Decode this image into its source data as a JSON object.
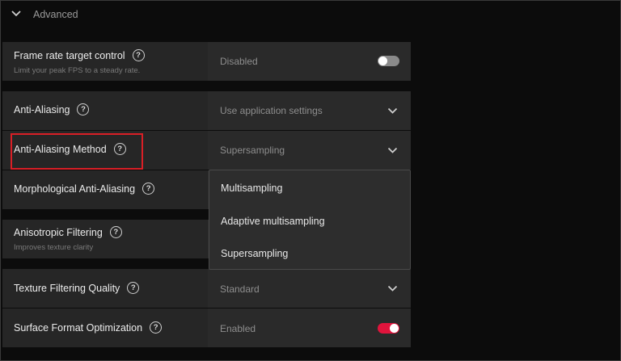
{
  "section": {
    "title": "Advanced"
  },
  "rows": {
    "frame_rate": {
      "label": "Frame rate target control",
      "sublabel": "Limit your peak FPS to a steady rate.",
      "value": "Disabled",
      "toggle_on": false
    },
    "anti_aliasing": {
      "label": "Anti-Aliasing",
      "value": "Use application settings"
    },
    "aa_method": {
      "label": "Anti-Aliasing Method",
      "value": "Supersampling"
    },
    "morphological": {
      "label": "Morphological Anti-Aliasing"
    },
    "anisotropic": {
      "label": "Anisotropic Filtering",
      "sublabel": "Improves texture clarity"
    },
    "texture_quality": {
      "label": "Texture Filtering Quality",
      "value": "Standard"
    },
    "surface_format": {
      "label": "Surface Format Optimization",
      "value": "Enabled",
      "toggle_on": true
    }
  },
  "help_glyph": "?",
  "dropdown": {
    "options": [
      "Multisampling",
      "Adaptive multisampling",
      "Supersampling"
    ]
  },
  "colors": {
    "toggle_off": "#8a8a8a",
    "toggle_on": "#e0143c",
    "highlight": "#d91f26"
  }
}
